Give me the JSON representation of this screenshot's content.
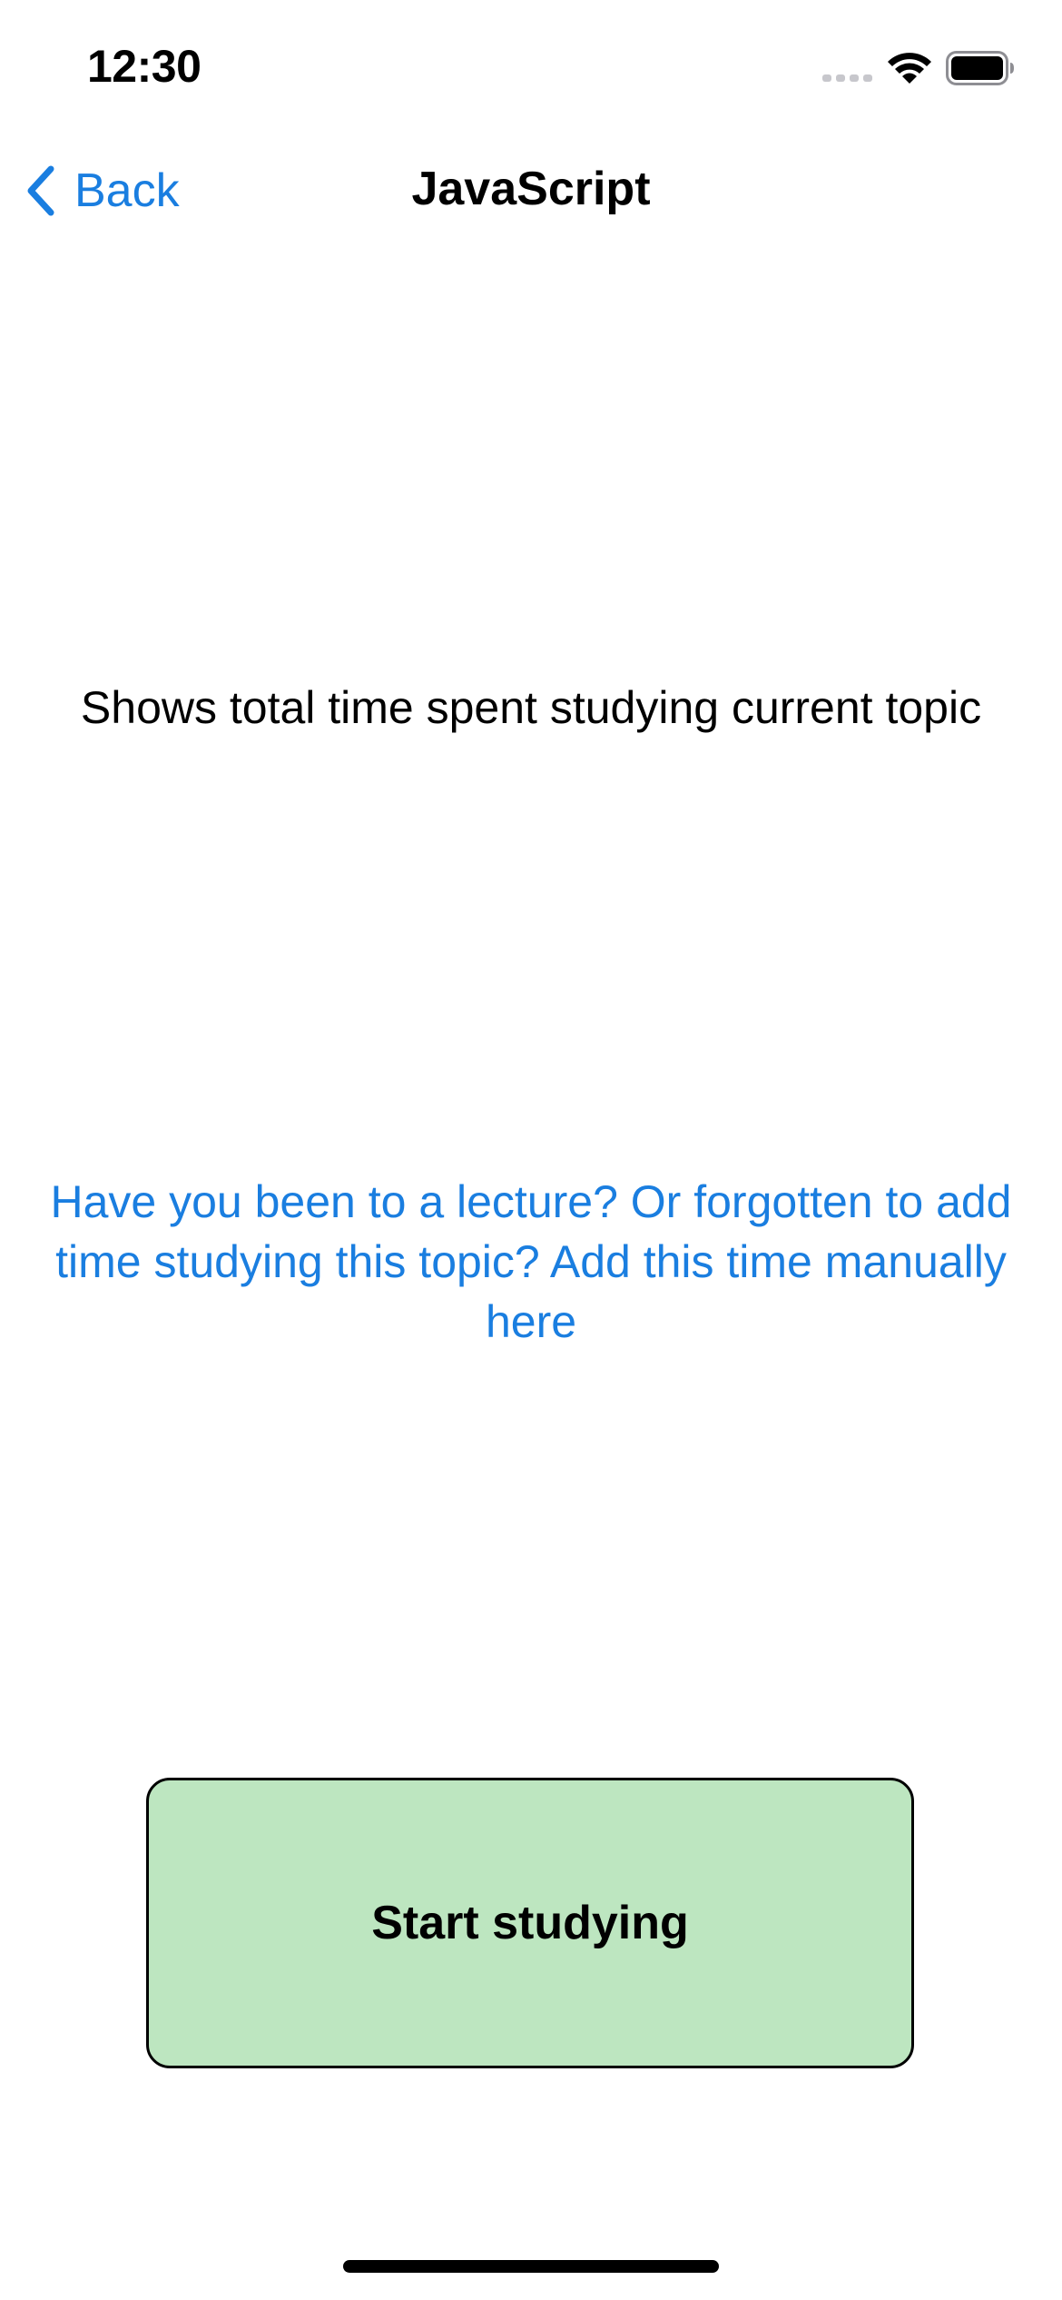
{
  "status_bar": {
    "time": "12:30",
    "icons": [
      "signal-icon",
      "wifi-icon",
      "battery-icon"
    ]
  },
  "nav": {
    "back_label": "Back",
    "back_icon": "chevron-left-icon",
    "title": "JavaScript"
  },
  "main": {
    "total_time_text": "Shows total time spent studying current topic",
    "manual_add_link": "Have you been to a lecture? Or forgotten to add time studying this topic? Add this time manually here",
    "start_button_label": "Start studying"
  },
  "colors": {
    "accent": "#1a7ee0",
    "start_button_bg": "#bde6c0",
    "start_button_border": "#000000"
  }
}
